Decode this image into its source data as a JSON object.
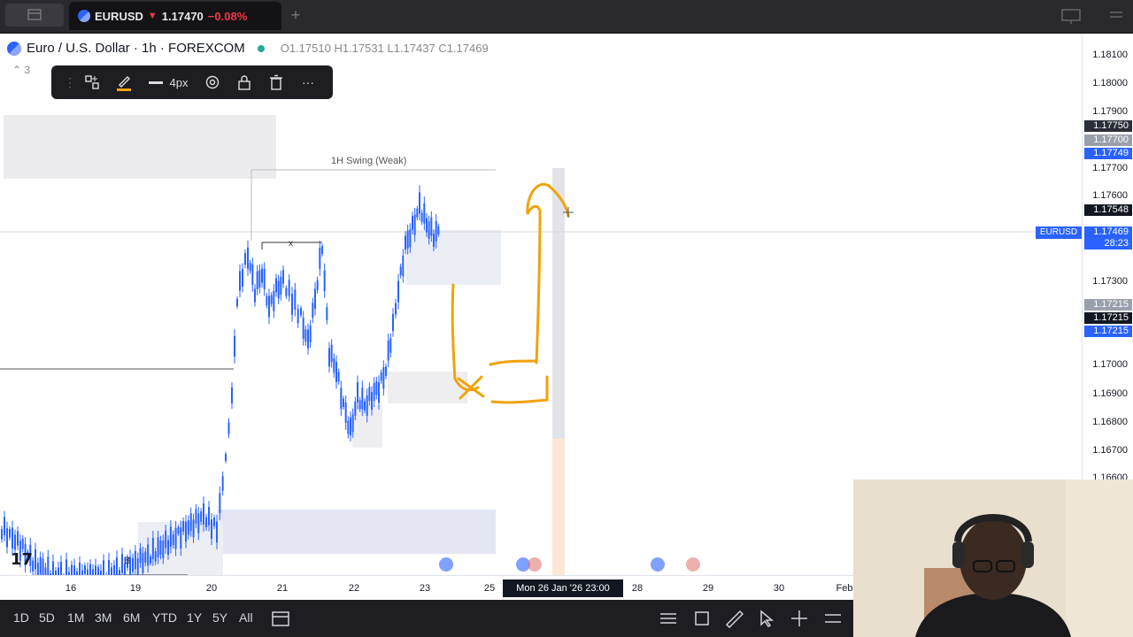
{
  "tabbar": {
    "symbol": "EURUSD",
    "price": "1.17470",
    "change": "−0.08%"
  },
  "legend": {
    "title": "Euro / U.S. Dollar · 1h · FOREXCOM",
    "open": "O1.17510",
    "high": "H1.17531",
    "low": "L1.17437",
    "close": "C1.17469",
    "indicators": "3"
  },
  "drawing_toolbar": {
    "width_label": "4px"
  },
  "annotations": {
    "swing_label": "1H Swing (Weak)",
    "x_marker": "x",
    "b_marker": "B"
  },
  "price_scale": {
    "ticks": [
      "1.18100",
      "1.18000",
      "1.17900",
      "1.17700",
      "1.17600",
      "1.17300",
      "1.17000",
      "1.16900",
      "1.16800",
      "1.16700",
      "1.16600"
    ],
    "labels": {
      "l1": "1.17750",
      "l2": "1.17700",
      "l3": "1.17749",
      "l4": "1.17548",
      "l5": "1.17469",
      "l6": "28:23",
      "l7": "1.17215",
      "l8": "1.17215",
      "l9": "1.17215"
    },
    "symbol_tag": "EURUSD"
  },
  "time_scale": {
    "ticks": [
      "16",
      "19",
      "20",
      "21",
      "22",
      "23",
      "25",
      "28",
      "29",
      "30",
      "Feb"
    ],
    "crosshair": "Mon 26 Jan '26   23:00"
  },
  "bottom_bar": {
    "ranges": [
      "1D",
      "5D",
      "1M",
      "3M",
      "6M",
      "YTD",
      "1Y",
      "5Y",
      "All"
    ]
  },
  "colors": {
    "up_candle": "#2962ff",
    "down_candle": "#2962ff",
    "drawing": "#f0a30a",
    "negative": "#f23645",
    "price_blue": "#2962ff"
  }
}
